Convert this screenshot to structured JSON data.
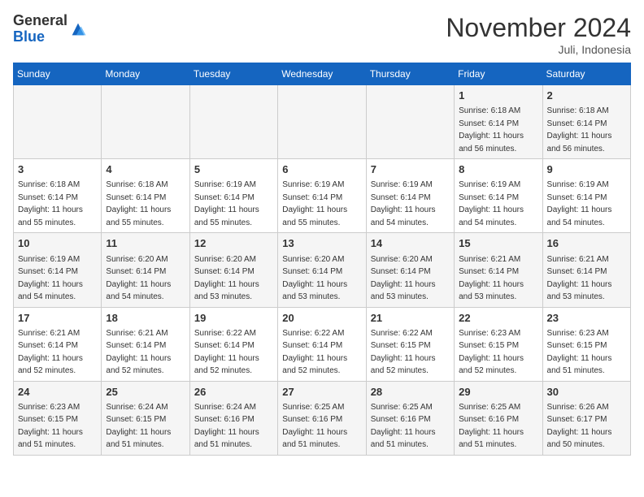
{
  "header": {
    "logo_general": "General",
    "logo_blue": "Blue",
    "month_title": "November 2024",
    "location": "Juli, Indonesia"
  },
  "weekdays": [
    "Sunday",
    "Monday",
    "Tuesday",
    "Wednesday",
    "Thursday",
    "Friday",
    "Saturday"
  ],
  "weeks": [
    [
      {
        "day": "",
        "info": ""
      },
      {
        "day": "",
        "info": ""
      },
      {
        "day": "",
        "info": ""
      },
      {
        "day": "",
        "info": ""
      },
      {
        "day": "",
        "info": ""
      },
      {
        "day": "1",
        "info": "Sunrise: 6:18 AM\nSunset: 6:14 PM\nDaylight: 11 hours\nand 56 minutes."
      },
      {
        "day": "2",
        "info": "Sunrise: 6:18 AM\nSunset: 6:14 PM\nDaylight: 11 hours\nand 56 minutes."
      }
    ],
    [
      {
        "day": "3",
        "info": "Sunrise: 6:18 AM\nSunset: 6:14 PM\nDaylight: 11 hours\nand 55 minutes."
      },
      {
        "day": "4",
        "info": "Sunrise: 6:18 AM\nSunset: 6:14 PM\nDaylight: 11 hours\nand 55 minutes."
      },
      {
        "day": "5",
        "info": "Sunrise: 6:19 AM\nSunset: 6:14 PM\nDaylight: 11 hours\nand 55 minutes."
      },
      {
        "day": "6",
        "info": "Sunrise: 6:19 AM\nSunset: 6:14 PM\nDaylight: 11 hours\nand 55 minutes."
      },
      {
        "day": "7",
        "info": "Sunrise: 6:19 AM\nSunset: 6:14 PM\nDaylight: 11 hours\nand 54 minutes."
      },
      {
        "day": "8",
        "info": "Sunrise: 6:19 AM\nSunset: 6:14 PM\nDaylight: 11 hours\nand 54 minutes."
      },
      {
        "day": "9",
        "info": "Sunrise: 6:19 AM\nSunset: 6:14 PM\nDaylight: 11 hours\nand 54 minutes."
      }
    ],
    [
      {
        "day": "10",
        "info": "Sunrise: 6:19 AM\nSunset: 6:14 PM\nDaylight: 11 hours\nand 54 minutes."
      },
      {
        "day": "11",
        "info": "Sunrise: 6:20 AM\nSunset: 6:14 PM\nDaylight: 11 hours\nand 54 minutes."
      },
      {
        "day": "12",
        "info": "Sunrise: 6:20 AM\nSunset: 6:14 PM\nDaylight: 11 hours\nand 53 minutes."
      },
      {
        "day": "13",
        "info": "Sunrise: 6:20 AM\nSunset: 6:14 PM\nDaylight: 11 hours\nand 53 minutes."
      },
      {
        "day": "14",
        "info": "Sunrise: 6:20 AM\nSunset: 6:14 PM\nDaylight: 11 hours\nand 53 minutes."
      },
      {
        "day": "15",
        "info": "Sunrise: 6:21 AM\nSunset: 6:14 PM\nDaylight: 11 hours\nand 53 minutes."
      },
      {
        "day": "16",
        "info": "Sunrise: 6:21 AM\nSunset: 6:14 PM\nDaylight: 11 hours\nand 53 minutes."
      }
    ],
    [
      {
        "day": "17",
        "info": "Sunrise: 6:21 AM\nSunset: 6:14 PM\nDaylight: 11 hours\nand 52 minutes."
      },
      {
        "day": "18",
        "info": "Sunrise: 6:21 AM\nSunset: 6:14 PM\nDaylight: 11 hours\nand 52 minutes."
      },
      {
        "day": "19",
        "info": "Sunrise: 6:22 AM\nSunset: 6:14 PM\nDaylight: 11 hours\nand 52 minutes."
      },
      {
        "day": "20",
        "info": "Sunrise: 6:22 AM\nSunset: 6:14 PM\nDaylight: 11 hours\nand 52 minutes."
      },
      {
        "day": "21",
        "info": "Sunrise: 6:22 AM\nSunset: 6:15 PM\nDaylight: 11 hours\nand 52 minutes."
      },
      {
        "day": "22",
        "info": "Sunrise: 6:23 AM\nSunset: 6:15 PM\nDaylight: 11 hours\nand 52 minutes."
      },
      {
        "day": "23",
        "info": "Sunrise: 6:23 AM\nSunset: 6:15 PM\nDaylight: 11 hours\nand 51 minutes."
      }
    ],
    [
      {
        "day": "24",
        "info": "Sunrise: 6:23 AM\nSunset: 6:15 PM\nDaylight: 11 hours\nand 51 minutes."
      },
      {
        "day": "25",
        "info": "Sunrise: 6:24 AM\nSunset: 6:15 PM\nDaylight: 11 hours\nand 51 minutes."
      },
      {
        "day": "26",
        "info": "Sunrise: 6:24 AM\nSunset: 6:16 PM\nDaylight: 11 hours\nand 51 minutes."
      },
      {
        "day": "27",
        "info": "Sunrise: 6:25 AM\nSunset: 6:16 PM\nDaylight: 11 hours\nand 51 minutes."
      },
      {
        "day": "28",
        "info": "Sunrise: 6:25 AM\nSunset: 6:16 PM\nDaylight: 11 hours\nand 51 minutes."
      },
      {
        "day": "29",
        "info": "Sunrise: 6:25 AM\nSunset: 6:16 PM\nDaylight: 11 hours\nand 51 minutes."
      },
      {
        "day": "30",
        "info": "Sunrise: 6:26 AM\nSunset: 6:17 PM\nDaylight: 11 hours\nand 50 minutes."
      }
    ]
  ]
}
